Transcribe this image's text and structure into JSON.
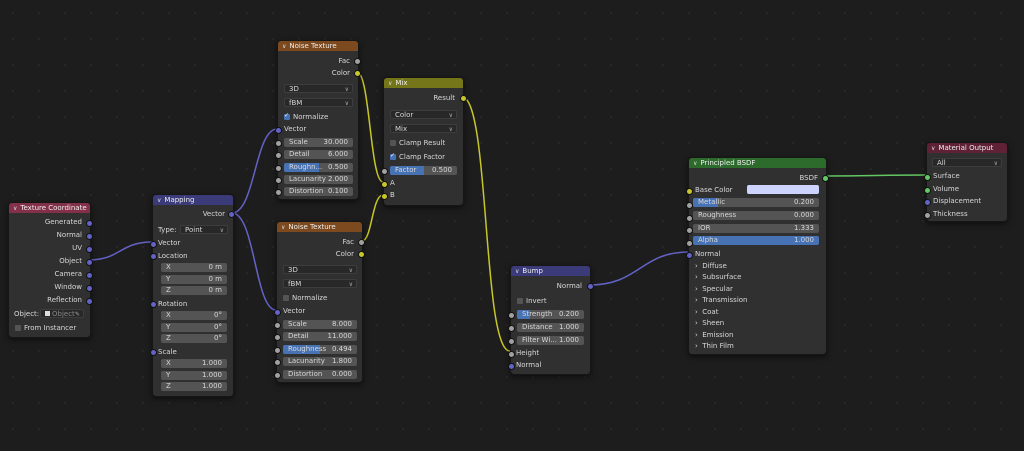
{
  "colors": {
    "vector_socket": "#6363c7",
    "color_socket": "#c7c729",
    "float_socket": "#a1a1a1",
    "shader_socket": "#63c763",
    "base_color": "#ccd4ff"
  },
  "tex_coord": {
    "title": "Texture Coordinate",
    "outputs": [
      "Generated",
      "Normal",
      "UV",
      "Object",
      "Camera",
      "Window",
      "Reflection"
    ],
    "object_label": "Object:",
    "object_placeholder": "Object",
    "from_instancer": "From Instancer"
  },
  "mapping": {
    "title": "Mapping",
    "output": "Vector",
    "type_label": "Type:",
    "type_value": "Point",
    "vector": "Vector",
    "location": "Location",
    "loc": [
      {
        "axis": "X",
        "val": "0 m"
      },
      {
        "axis": "Y",
        "val": "0 m"
      },
      {
        "axis": "Z",
        "val": "0 m"
      }
    ],
    "rotation": "Rotation",
    "rot": [
      {
        "axis": "X",
        "val": "0°"
      },
      {
        "axis": "Y",
        "val": "0°"
      },
      {
        "axis": "Z",
        "val": "0°"
      }
    ],
    "scale": "Scale",
    "scl": [
      {
        "axis": "X",
        "val": "1.000"
      },
      {
        "axis": "Y",
        "val": "1.000"
      },
      {
        "axis": "Z",
        "val": "1.000"
      }
    ]
  },
  "noise1": {
    "title": "Noise Texture",
    "out_fac": "Fac",
    "out_color": "Color",
    "dim": "3D",
    "type": "fBM",
    "normalize": "Normalize",
    "vector": "Vector",
    "fields": [
      {
        "label": "Scale",
        "val": "30.000",
        "fill": 0
      },
      {
        "label": "Detail",
        "val": "6.000",
        "fill": 0
      },
      {
        "label": "Roughn...",
        "val": "0.500",
        "fill": 0.5
      },
      {
        "label": "Lacunarity",
        "val": "2.000",
        "fill": 0
      },
      {
        "label": "Distortion",
        "val": "0.100",
        "fill": 0
      }
    ]
  },
  "noise2": {
    "title": "Noise Texture",
    "out_fac": "Fac",
    "out_color": "Color",
    "dim": "3D",
    "type": "fBM",
    "normalize": "Normalize",
    "vector": "Vector",
    "fields": [
      {
        "label": "Scale",
        "val": "8.000",
        "fill": 0
      },
      {
        "label": "Detail",
        "val": "11.000",
        "fill": 0
      },
      {
        "label": "Roughness",
        "val": "0.494",
        "fill": 0.494
      },
      {
        "label": "Lacunarity",
        "val": "1.800",
        "fill": 0
      },
      {
        "label": "Distortion",
        "val": "0.000",
        "fill": 0
      }
    ]
  },
  "mix": {
    "title": "Mix",
    "result": "Result",
    "data_type": "Color",
    "blend": "Mix",
    "clamp_result": "Clamp Result",
    "clamp_factor": "Clamp Factor",
    "factor_label": "Factor",
    "factor_val": "0.500",
    "a": "A",
    "b": "B"
  },
  "bump": {
    "title": "Bump",
    "out": "Normal",
    "invert": "Invert",
    "fields": [
      {
        "label": "Strength",
        "val": "0.200",
        "fill": 0.2
      },
      {
        "label": "Distance",
        "val": "1.000",
        "fill": 0
      },
      {
        "label": "Filter Wi...",
        "val": "1.000",
        "fill": 0
      }
    ],
    "height": "Height",
    "normal": "Normal"
  },
  "bsdf": {
    "title": "Principled BSDF",
    "out": "BSDF",
    "base_color": "Base Color",
    "fields": [
      {
        "label": "Metallic",
        "val": "0.200",
        "fill": 0.2
      },
      {
        "label": "Roughness",
        "val": "0.000",
        "fill": 0
      },
      {
        "label": "IOR",
        "val": "1.333",
        "fill": 0
      },
      {
        "label": "Alpha",
        "val": "1.000",
        "fill": 1
      }
    ],
    "normal": "Normal",
    "panels": [
      "Diffuse",
      "Subsurface",
      "Specular",
      "Transmission",
      "Coat",
      "Sheen",
      "Emission",
      "Thin Film"
    ]
  },
  "output": {
    "title": "Material Output",
    "target": "All",
    "inputs": [
      "Surface",
      "Volume",
      "Displacement",
      "Thickness"
    ]
  }
}
